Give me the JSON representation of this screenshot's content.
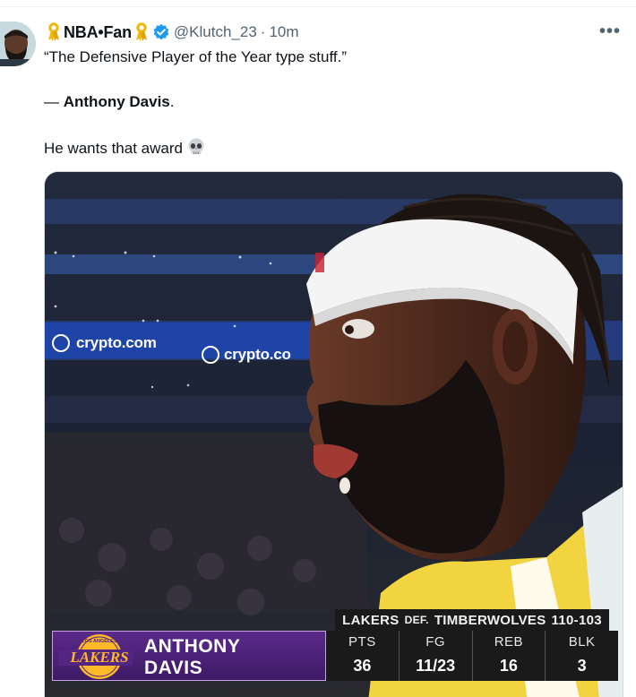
{
  "post": {
    "display_name": "NBA•Fan",
    "handle": "@Klutch_23",
    "separator": "·",
    "time": "10m",
    "more_label": "•••",
    "badges": [
      "ribbon-icon",
      "verified-badge-icon"
    ]
  },
  "tweet": {
    "line1": "“The Defensive Player of the Year type stuff.”",
    "line2_prefix": "— ",
    "line2_name": "Anthony Davis",
    "line2_suffix": ".",
    "line3": "He wants that award",
    "emoji": "skull-icon"
  },
  "media": {
    "signage": [
      "crypto.com",
      "crypto.co"
    ],
    "scorebug": {
      "winner": "LAKERS",
      "def_label": "DEF.",
      "loser": "TIMBERWOLVES",
      "score": "110-103",
      "logo_text": "LAKERS",
      "logo_top_text": "LOS ANGELES",
      "player_first": "ANTHONY",
      "player_last": "DAVIS",
      "stats": [
        {
          "label": "PTS",
          "value": "36"
        },
        {
          "label": "FG",
          "value": "11/23"
        },
        {
          "label": "REB",
          "value": "16"
        },
        {
          "label": "BLK",
          "value": "3"
        }
      ]
    }
  },
  "colors": {
    "text": "#0f1419",
    "secondary": "#536471",
    "verified": "#1d9bf0",
    "ribbon": "#f2b705",
    "lakers_purple": "#552583",
    "lakers_gold": "#fdb927"
  }
}
